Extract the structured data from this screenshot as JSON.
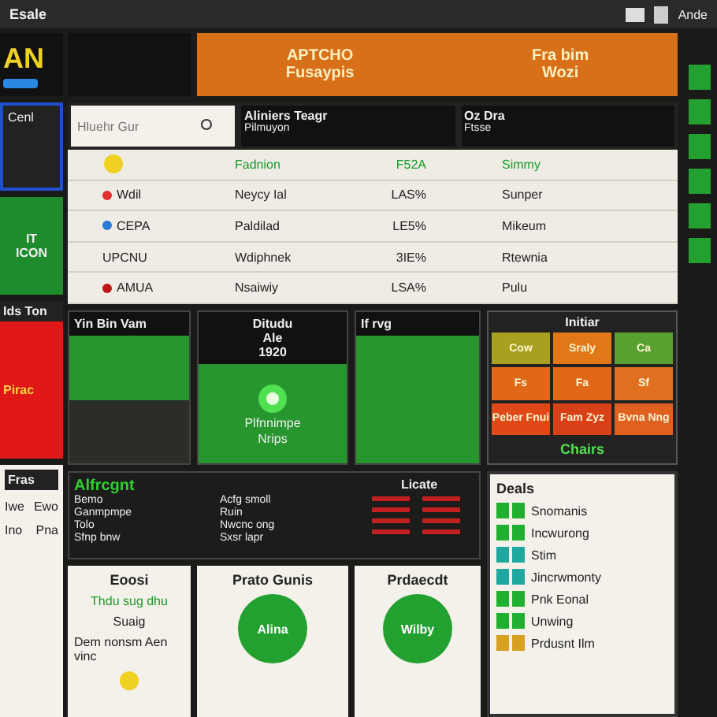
{
  "top_bar": {
    "title": "Esale",
    "user": "Ande"
  },
  "logo": {
    "text": "AN"
  },
  "banner": {
    "left": [
      "APTCHO",
      "Fusaypis"
    ],
    "right": [
      "Fra bim",
      "Wozi"
    ]
  },
  "sidebar": {
    "panel_title": "Cenl",
    "green_panel": [
      "IT",
      "ICON"
    ],
    "red_panel": {
      "title": "Ids Ton",
      "label": "Pirac"
    },
    "white_panel": {
      "title": "Fras",
      "rows": [
        [
          "Iwe",
          "Ewo"
        ],
        [
          "Ino",
          "Pna"
        ]
      ]
    }
  },
  "table": {
    "search": {
      "placeholder": "Hluehr Gur"
    },
    "columns": [
      {
        "title": "Aliniers Teagr",
        "subtitle": "Pilmuyon"
      },
      {
        "title": "Oz Dra",
        "subtitle": "Ftsse"
      }
    ],
    "rows": [
      {
        "kind": "sun",
        "name": "",
        "value": "Fadnion",
        "percent": "F52A",
        "status": "Simmy",
        "highlight": true
      },
      {
        "kind": "dot",
        "color": "#e03030",
        "name": "Wdil",
        "value": "Neycy Ial",
        "percent": "LAS%",
        "status": "Sunper",
        "highlight": false
      },
      {
        "kind": "dot",
        "color": "#2a7ad8",
        "name": "CEPA",
        "value": "Paldilad",
        "percent": "LE5%",
        "status": "Mikeum",
        "highlight": false
      },
      {
        "kind": "none",
        "name": "UPCNU",
        "value": "Wdiphnek",
        "percent": "3IE%",
        "status": "Rtewnia",
        "highlight": false
      },
      {
        "kind": "dot",
        "color": "#c01818",
        "name": "AMUA",
        "value": "Nsaiwiy",
        "percent": "LSA%",
        "status": "Pulu",
        "highlight": false
      }
    ]
  },
  "panels": {
    "first": {
      "title": "Yin Bin Vam"
    },
    "second": {
      "lines": [
        "Ditudu",
        "Ale",
        "1920"
      ],
      "caption": [
        "Plfnnimpe",
        "Nrips"
      ]
    },
    "third": {
      "title": "If rvg"
    },
    "grid": {
      "title": "Initiar",
      "footer": "Chairs",
      "tiles": [
        {
          "label": "Cow",
          "color": "#a8a020"
        },
        {
          "label": "Sraly",
          "color": "#e07818"
        },
        {
          "label": "Ca",
          "color": "#58a030"
        },
        {
          "label": "Fs",
          "color": "#e06818"
        },
        {
          "label": "Fa",
          "color": "#e06818"
        },
        {
          "label": "Sf",
          "color": "#e07020"
        },
        {
          "label": "Peber Fnui",
          "color": "#e04818"
        },
        {
          "label": "Fam Zyz",
          "color": "#d84018"
        },
        {
          "label": "Bvna Nng",
          "color": "#e06020"
        }
      ]
    }
  },
  "summary": {
    "title": "Alfrcgnt",
    "rows": [
      [
        "Bemo",
        "Acfg smoll"
      ],
      [
        "Ganmpmpe",
        "Ruin"
      ],
      [
        "Tolo",
        "Nwcnc ong"
      ],
      [
        "Sfnp bnw",
        "Sxsr lapr"
      ]
    ],
    "side_title": "Licate"
  },
  "deals": {
    "title": "Deals",
    "items": [
      {
        "label": "Snomanis",
        "color": "#20b030"
      },
      {
        "label": "Incwurong",
        "color": "#20b030"
      },
      {
        "label": "Stim",
        "color": "#20a8a0"
      },
      {
        "label": "Jincrwmonty",
        "color": "#20a8a0"
      },
      {
        "label": "Pnk Eonal",
        "color": "#20b030"
      },
      {
        "label": "Unwing",
        "color": "#20b030"
      },
      {
        "label": "Prdusnt Ilm",
        "color": "#d8a020"
      }
    ]
  },
  "cards": [
    {
      "kind": "text",
      "title": "Eoosi",
      "lines": [
        "Thdu sug dhu",
        "Suaig",
        "Dem nonsm Aen vinc"
      ]
    },
    {
      "kind": "circle",
      "title": "Prato Gunis",
      "circle_label": "Alina"
    },
    {
      "kind": "circle",
      "title": "Prdaecdt",
      "circle_label": "Wilby"
    }
  ]
}
